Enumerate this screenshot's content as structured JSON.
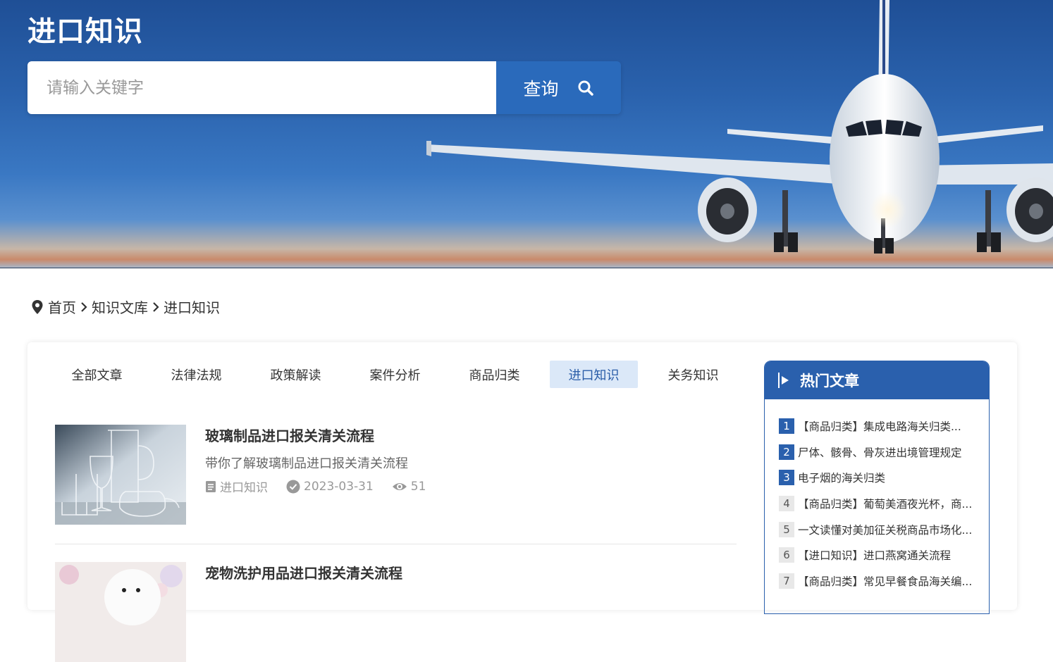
{
  "hero": {
    "title": "进口知识",
    "search_placeholder": "请输入关键字",
    "search_button": "查询"
  },
  "breadcrumb": {
    "items": [
      "首页",
      "知识文库",
      "进口知识"
    ]
  },
  "tabs": [
    {
      "label": "全部文章",
      "active": false
    },
    {
      "label": "法律法规",
      "active": false
    },
    {
      "label": "政策解读",
      "active": false
    },
    {
      "label": "案件分析",
      "active": false
    },
    {
      "label": "商品归类",
      "active": false
    },
    {
      "label": "进口知识",
      "active": true
    },
    {
      "label": "关务知识",
      "active": false
    }
  ],
  "articles": [
    {
      "title": "玻璃制品进口报关清关流程",
      "description": "带你了解玻璃制品进口报关清关流程",
      "category": "进口知识",
      "date": "2023-03-31",
      "views": "51"
    },
    {
      "title": "宠物洗护用品进口报关清关流程"
    }
  ],
  "hot": {
    "title": "热门文章",
    "items": [
      {
        "rank": "1",
        "text": "【商品归类】集成电路海关归类..."
      },
      {
        "rank": "2",
        "text": "尸体、骸骨、骨灰进出境管理规定"
      },
      {
        "rank": "3",
        "text": "电子烟的海关归类"
      },
      {
        "rank": "4",
        "text": "【商品归类】葡萄美酒夜光杯，商..."
      },
      {
        "rank": "5",
        "text": "一文读懂对美加征关税商品市场化..."
      },
      {
        "rank": "6",
        "text": "【进口知识】进口燕窝通关流程"
      },
      {
        "rank": "7",
        "text": "【商品归类】常见早餐食品海关编..."
      }
    ]
  },
  "colors": {
    "brand_blue": "#2a60ad",
    "tab_active_bg": "#dbe8f8"
  }
}
